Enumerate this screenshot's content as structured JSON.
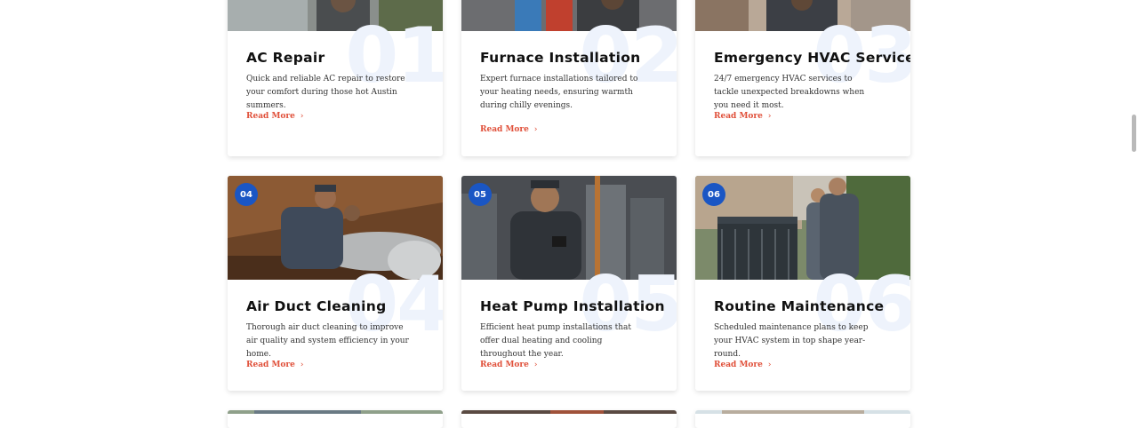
{
  "read_more_label": "Read More",
  "chevron_glyph": "›",
  "colors": {
    "accent": "#e0503a",
    "badge": "#1a56c4",
    "watermark": "#eef3fc"
  },
  "services": [
    {
      "number": "01",
      "title": "AC Repair",
      "description": "Quick and reliable AC repair to restore your comfort during those hot Austin summers."
    },
    {
      "number": "02",
      "title": "Furnace Installation",
      "description": "Expert furnace installations tailored to your heating needs, ensuring warmth during chilly evenings."
    },
    {
      "number": "03",
      "title": "Emergency HVAC Services",
      "description": "24/7 emergency HVAC services to tackle unexpected breakdowns when you need it most."
    },
    {
      "number": "04",
      "title": "Air Duct Cleaning",
      "description": "Thorough air duct cleaning to improve air quality and system efficiency in your home."
    },
    {
      "number": "05",
      "title": "Heat Pump Installation",
      "description": "Efficient heat pump installations that offer dual heating and cooling throughout the year."
    },
    {
      "number": "06",
      "title": "Routine Maintenance",
      "description": "Scheduled maintenance plans to keep your HVAC system in top shape year-round."
    }
  ]
}
